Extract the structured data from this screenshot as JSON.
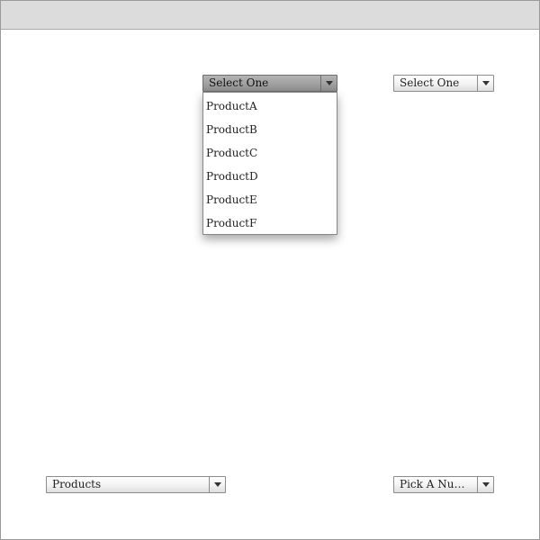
{
  "selects": {
    "top_left": {
      "value": "Select One"
    },
    "top_right": {
      "value": "Select One"
    },
    "bottom_left": {
      "value": "Products"
    },
    "bottom_right": {
      "value": "Pick A Num..."
    }
  },
  "dropdown": {
    "options": [
      "ProductA",
      "ProductB",
      "ProductC",
      "ProductD",
      "ProductE",
      "ProductF"
    ]
  }
}
